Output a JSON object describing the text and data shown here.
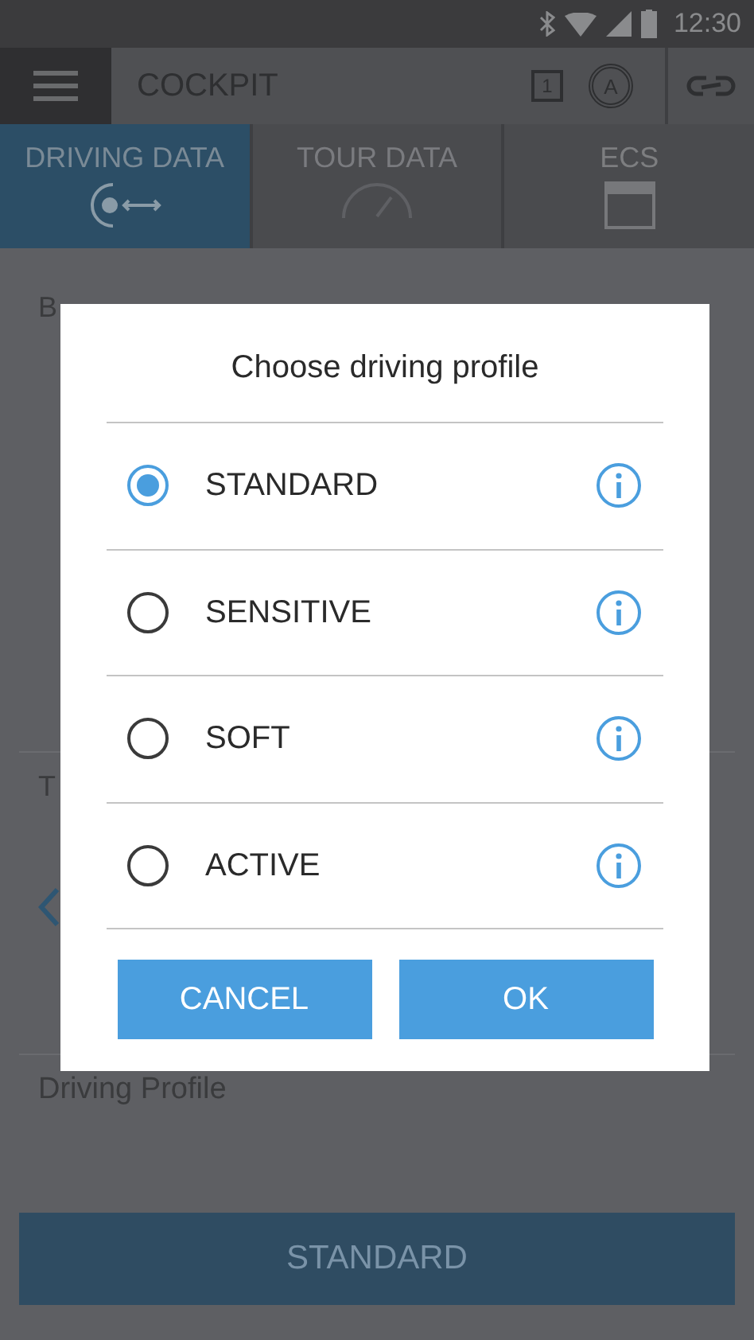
{
  "status_bar": {
    "time": "12:30"
  },
  "app_bar": {
    "title": "COCKPIT",
    "slot_badge": "1",
    "mode_badge": "A"
  },
  "tabs": [
    {
      "label": "DRIVING DATA",
      "selected": true,
      "kind": "drive"
    },
    {
      "label": "TOUR DATA",
      "selected": false,
      "kind": "gauge"
    },
    {
      "label": "ECS",
      "selected": false,
      "kind": "box"
    }
  ],
  "content": {
    "section_1_label": "B",
    "section_2_label": "T",
    "driving_profile_label": "Driving Profile",
    "profile_button": "STANDARD"
  },
  "dialog": {
    "title": "Choose driving profile",
    "options": [
      {
        "label": "STANDARD",
        "selected": true
      },
      {
        "label": "SENSITIVE",
        "selected": false
      },
      {
        "label": "SOFT",
        "selected": false
      },
      {
        "label": "ACTIVE",
        "selected": false
      }
    ],
    "buttons": [
      "CANCEL",
      "OK"
    ]
  }
}
